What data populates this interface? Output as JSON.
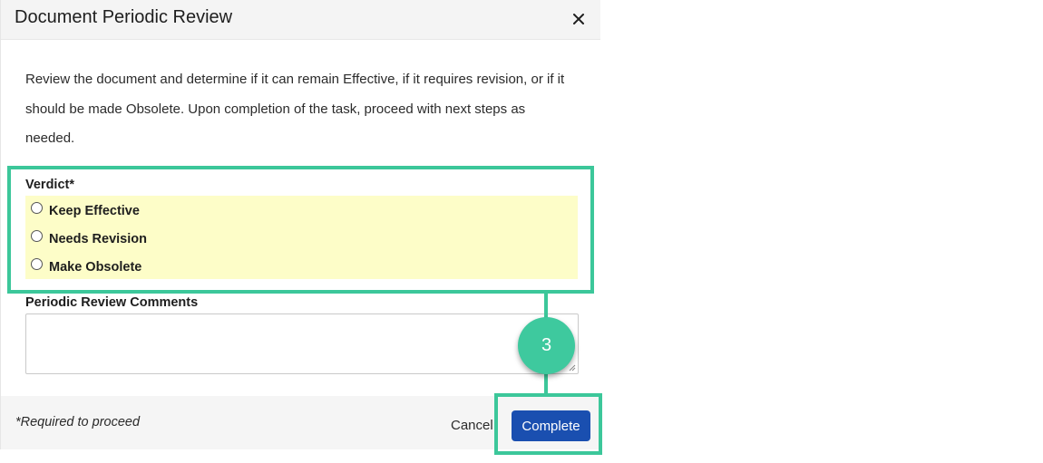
{
  "dialog": {
    "title": "Document Periodic Review",
    "intro_lines": [
      "Review the document and determine if it can remain Effective, if it requires revision, or if it",
      "should be made Obsolete. Upon completion of the task, proceed with next steps as",
      "needed."
    ]
  },
  "verdict": {
    "label": "Verdict*",
    "options": [
      "Keep Effective",
      "Needs Revision",
      "Make Obsolete"
    ]
  },
  "comments": {
    "label": "Periodic Review Comments",
    "value": ""
  },
  "footer": {
    "required_note": "*Required to proceed",
    "cancel_label": "Cancel",
    "complete_label": "Complete"
  },
  "annotation": {
    "step_number": "3",
    "highlight_color": "#3cc79a"
  },
  "colors": {
    "primary_button": "#1a4fb0",
    "verdict_background": "#fdfdc8"
  }
}
